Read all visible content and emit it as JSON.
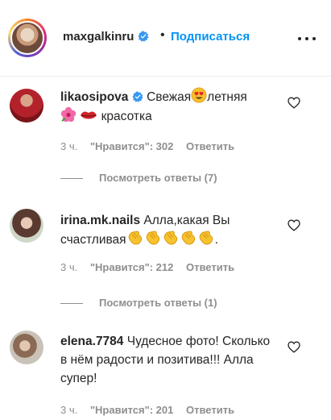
{
  "header": {
    "username": "maxgalkinru",
    "separator": "•",
    "follow_label": "Подписаться"
  },
  "comments": [
    {
      "username": "likaosipova",
      "verified": true,
      "text_part1": "Свежая",
      "text_part2": "летняя",
      "text_part3": "красотка",
      "time": "3 ч.",
      "likes": "\"Нравится\": 302",
      "reply": "Ответить",
      "view_replies": "Посмотреть ответы (7)"
    },
    {
      "username": "irina.mk.nails",
      "text_part1": "Алла,какая Вы счастливая",
      "text_part2": ".",
      "time": "3 ч.",
      "likes": "\"Нравится\": 212",
      "reply": "Ответить",
      "view_replies": "Посмотреть ответы (1)"
    },
    {
      "username": "elena.7784",
      "text": "Чудесное фото! Сколько в нём радости и позитива!!! Алла супер!",
      "time": "3 ч.",
      "likes": "\"Нравится\": 201",
      "reply": "Ответить"
    }
  ],
  "icons": {
    "verified": "verified-badge-icon",
    "more": "more-options-icon",
    "heart": "heart-outline-icon",
    "emoji_heart_eyes": "heart-eyes-emoji",
    "emoji_flower": "hibiscus-emoji",
    "emoji_lips": "lips-emoji",
    "emoji_clap": "clapping-hands-emoji"
  },
  "colors": {
    "accent": "#0095f6",
    "verified": "#3897f0",
    "secondary_text": "#8e8e8e",
    "primary_text": "#262626"
  }
}
